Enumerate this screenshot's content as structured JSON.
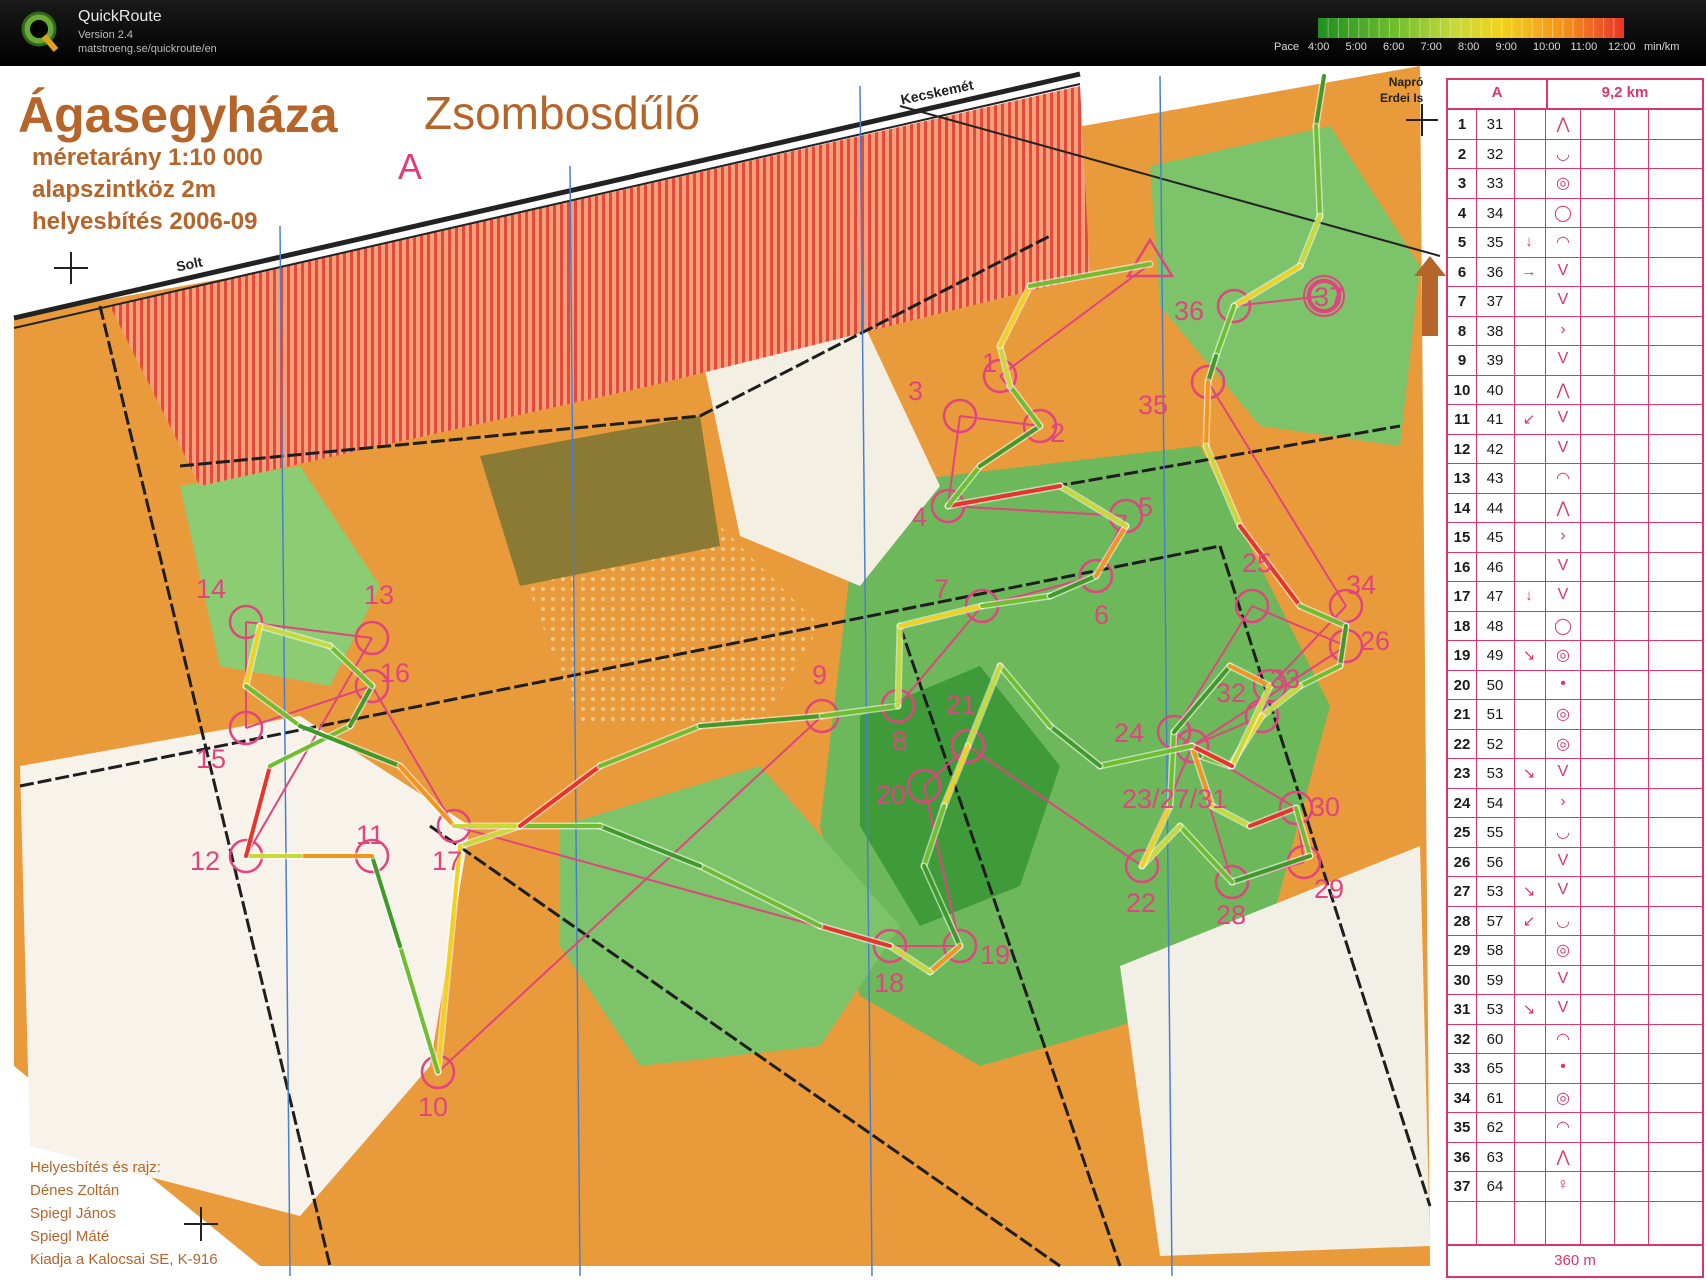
{
  "app": {
    "title": "QuickRoute",
    "version": "Version 2.4",
    "url": "matstroeng.se/quickroute/en"
  },
  "pace_legend": {
    "label": "Pace",
    "ticks": [
      "4:00",
      "5:00",
      "6:00",
      "7:00",
      "8:00",
      "9:00",
      "10:00",
      "11:00",
      "12:00"
    ],
    "unit": "min/km",
    "colors": [
      "#1f8f1f",
      "#6fbe2e",
      "#c8d936",
      "#f0d21e",
      "#f5941a",
      "#e8342a"
    ]
  },
  "map": {
    "title": "Ágasegyháza",
    "subtitle": "Zsombosdűlő",
    "course_letter": "A",
    "scale_line": "méretarány  1:10 000",
    "contour_line": "alapszintköz  2m",
    "update_line": "helyesbítés  2006-09",
    "road_solt": "Solt",
    "road_kecskemet": "Kecskemét",
    "north_label_1": "Napró",
    "north_label_2": "Erdei Is",
    "credits": [
      "Helyesbítés és rajz:",
      "Dénes Zoltán",
      "Spiegl János",
      "Spiegl Máté",
      "Kiadja a Kalocsai SE, K-916"
    ],
    "colors": {
      "open_land": "#e99a3a",
      "forest_green": "#6db85a",
      "dark_green": "#3f9a3a",
      "forbidden": "#e8473a",
      "course": "#e0457f",
      "track": "#1e1e1e"
    }
  },
  "description_sheet": {
    "course": "A",
    "length": "9,2 km",
    "footer_distance": "360 m",
    "rows": [
      {
        "num": "1",
        "code": "31",
        "dir": "",
        "feat": "⋀"
      },
      {
        "num": "2",
        "code": "32",
        "dir": "",
        "feat": "◡"
      },
      {
        "num": "3",
        "code": "33",
        "dir": "",
        "feat": "◎"
      },
      {
        "num": "4",
        "code": "34",
        "dir": "",
        "feat": "◯"
      },
      {
        "num": "5",
        "code": "35",
        "dir": "↓",
        "feat": "◠"
      },
      {
        "num": "6",
        "code": "36",
        "dir": "→",
        "feat": "V"
      },
      {
        "num": "7",
        "code": "37",
        "dir": "",
        "feat": "V"
      },
      {
        "num": "8",
        "code": "38",
        "dir": "",
        "feat": "›"
      },
      {
        "num": "9",
        "code": "39",
        "dir": "",
        "feat": "V"
      },
      {
        "num": "10",
        "code": "40",
        "dir": "",
        "feat": "⋀"
      },
      {
        "num": "11",
        "code": "41",
        "dir": "↙",
        "feat": "V"
      },
      {
        "num": "12",
        "code": "42",
        "dir": "",
        "feat": "V"
      },
      {
        "num": "13",
        "code": "43",
        "dir": "",
        "feat": "◠"
      },
      {
        "num": "14",
        "code": "44",
        "dir": "",
        "feat": "⋀"
      },
      {
        "num": "15",
        "code": "45",
        "dir": "",
        "feat": "›"
      },
      {
        "num": "16",
        "code": "46",
        "dir": "",
        "feat": "V"
      },
      {
        "num": "17",
        "code": "47",
        "dir": "↓",
        "feat": "V"
      },
      {
        "num": "18",
        "code": "48",
        "dir": "",
        "feat": "◯"
      },
      {
        "num": "19",
        "code": "49",
        "dir": "↘",
        "feat": "◎"
      },
      {
        "num": "20",
        "code": "50",
        "dir": "",
        "feat": "•"
      },
      {
        "num": "21",
        "code": "51",
        "dir": "",
        "feat": "◎"
      },
      {
        "num": "22",
        "code": "52",
        "dir": "",
        "feat": "◎"
      },
      {
        "num": "23",
        "code": "53",
        "dir": "↘",
        "feat": "V"
      },
      {
        "num": "24",
        "code": "54",
        "dir": "",
        "feat": "›"
      },
      {
        "num": "25",
        "code": "55",
        "dir": "",
        "feat": "◡"
      },
      {
        "num": "26",
        "code": "56",
        "dir": "",
        "feat": "V"
      },
      {
        "num": "27",
        "code": "53",
        "dir": "↘",
        "feat": "V"
      },
      {
        "num": "28",
        "code": "57",
        "dir": "↙",
        "feat": "◡"
      },
      {
        "num": "29",
        "code": "58",
        "dir": "",
        "feat": "◎"
      },
      {
        "num": "30",
        "code": "59",
        "dir": "",
        "feat": "V"
      },
      {
        "num": "31",
        "code": "53",
        "dir": "↘",
        "feat": "V"
      },
      {
        "num": "32",
        "code": "60",
        "dir": "",
        "feat": "◠"
      },
      {
        "num": "33",
        "code": "65",
        "dir": "",
        "feat": "•"
      },
      {
        "num": "34",
        "code": "61",
        "dir": "",
        "feat": "◎"
      },
      {
        "num": "35",
        "code": "62",
        "dir": "",
        "feat": "◠"
      },
      {
        "num": "36",
        "code": "63",
        "dir": "",
        "feat": "⋀"
      },
      {
        "num": "37",
        "code": "64",
        "dir": "",
        "feat": "♀"
      }
    ]
  },
  "controls": [
    {
      "label": "1"
    },
    {
      "label": "2"
    },
    {
      "label": "3"
    },
    {
      "label": "4"
    },
    {
      "label": "5"
    },
    {
      "label": "6"
    },
    {
      "label": "7"
    },
    {
      "label": "8"
    },
    {
      "label": "9"
    },
    {
      "label": "10"
    },
    {
      "label": "11"
    },
    {
      "label": "12"
    },
    {
      "label": "13"
    },
    {
      "label": "14"
    },
    {
      "label": "15"
    },
    {
      "label": "16"
    },
    {
      "label": "17"
    },
    {
      "label": "18"
    },
    {
      "label": "19"
    },
    {
      "label": "20"
    },
    {
      "label": "21"
    },
    {
      "label": "22"
    },
    {
      "label": "23/27/31"
    },
    {
      "label": "24"
    },
    {
      "label": "25"
    },
    {
      "label": "26"
    },
    {
      "label": "28"
    },
    {
      "label": "29"
    },
    {
      "label": "30"
    },
    {
      "label": "32"
    },
    {
      "label": "33"
    },
    {
      "label": "34"
    },
    {
      "label": "35"
    },
    {
      "label": "36"
    },
    {
      "label": "37"
    }
  ]
}
